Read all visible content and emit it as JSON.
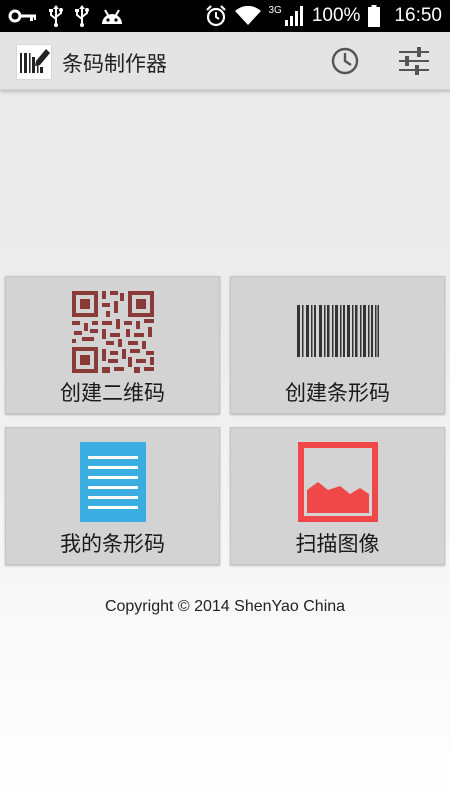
{
  "status_bar": {
    "battery": "100%",
    "time": "16:50",
    "network": "3G"
  },
  "action_bar": {
    "title": "条码制作器",
    "icons": [
      "barcode-pen-logo-icon",
      "history-clock-icon",
      "settings-sliders-icon"
    ]
  },
  "tiles": [
    {
      "label": "创建二维码",
      "icon": "qr-code-icon",
      "color": "#8b3a3a"
    },
    {
      "label": "创建条形码",
      "icon": "barcode-icon",
      "color": "#333333"
    },
    {
      "label": "我的条形码",
      "icon": "document-list-icon",
      "color": "#3aaee0"
    },
    {
      "label": "扫描图像",
      "icon": "image-icon",
      "color": "#f04848"
    }
  ],
  "footer": {
    "copyright": "Copyright © 2014 ShenYao China"
  }
}
